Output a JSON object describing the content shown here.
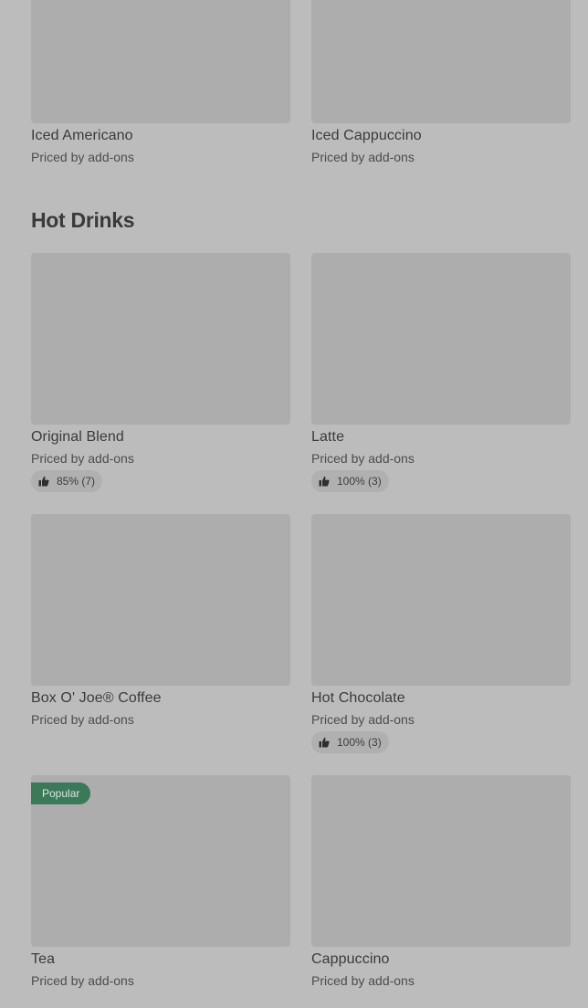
{
  "sections": [
    {
      "title": "",
      "items": [
        {
          "name": "Iced Americano",
          "price": "Priced by add-ons"
        },
        {
          "name": "Iced Cappuccino",
          "price": "Priced by add-ons"
        }
      ]
    },
    {
      "title": "Hot Drinks",
      "items": [
        {
          "name": "Original Blend",
          "price": "Priced by add-ons",
          "rating": "85% (7)"
        },
        {
          "name": "Latte",
          "price": "Priced by add-ons",
          "rating": "100% (3)"
        },
        {
          "name": "Box O' Joe® Coffee",
          "price": "Priced by add-ons"
        },
        {
          "name": "Hot Chocolate",
          "price": "Priced by add-ons",
          "rating": "100% (3)"
        },
        {
          "name": "Tea",
          "price": "Priced by add-ons",
          "badge": "Popular"
        },
        {
          "name": "Cappuccino",
          "price": "Priced by add-ons"
        }
      ]
    }
  ],
  "icons": {
    "rating": "thumbs-up-icon"
  },
  "colors": {
    "background": "#bcbcbc",
    "image_placeholder": "#adadad",
    "rating_pill": "#b0b0b0",
    "badge": "#3b7a58"
  }
}
